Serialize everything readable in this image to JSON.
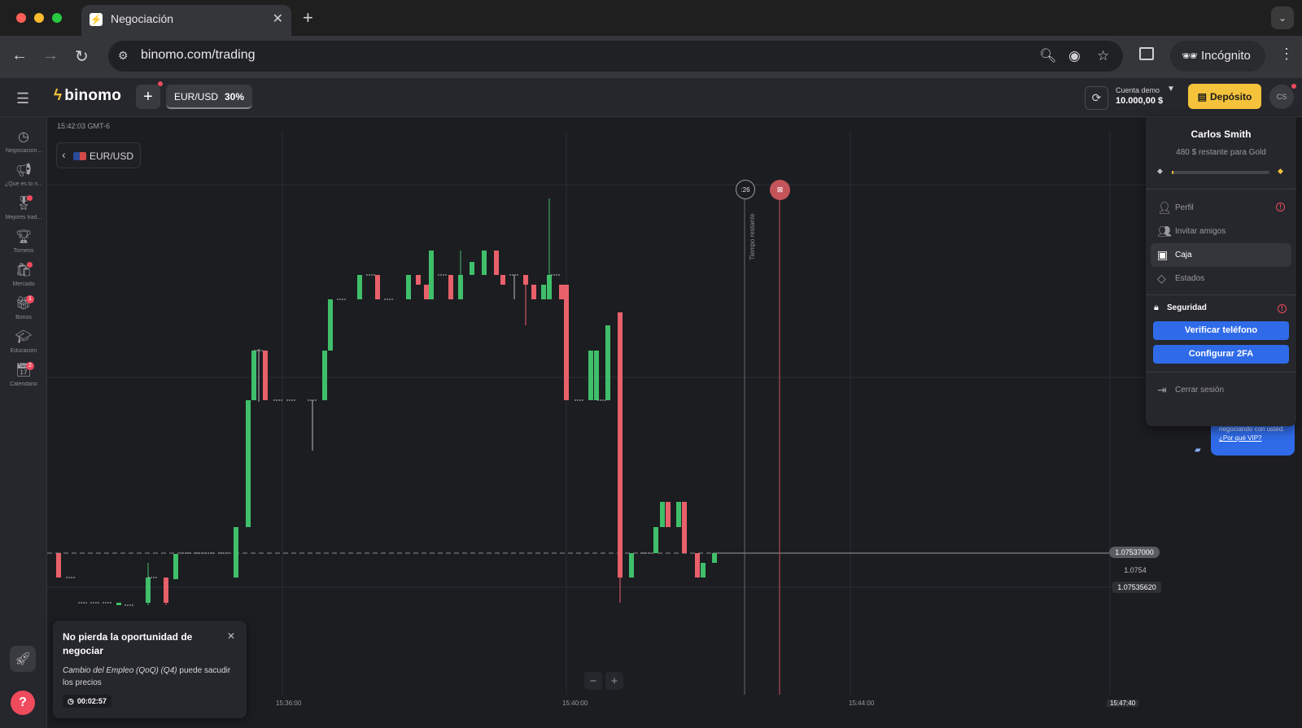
{
  "browser": {
    "tab_title": "Negociación",
    "url": "binomo.com/trading",
    "incognito_label": "Incógnito"
  },
  "header": {
    "logo": "binomo",
    "asset_chip": {
      "name": "EUR/USD",
      "payout": "30%"
    },
    "account_label": "Cuenta demo",
    "account_balance": "10.000,00 $",
    "deposit_label": "Depósito",
    "avatar_initials": "CS"
  },
  "sidebar": {
    "items": [
      {
        "label": "Negociacion...",
        "icon": "clock-icon",
        "badge": ""
      },
      {
        "label": "¿Qué es lo n...",
        "icon": "megaphone-icon",
        "badge": ""
      },
      {
        "label": "Mejores trad...",
        "icon": "ribbon-icon",
        "badge": ""
      },
      {
        "label": "Torneos",
        "icon": "trophy-icon",
        "badge": ""
      },
      {
        "label": "Mercado",
        "icon": "shop-icon",
        "badge": ""
      },
      {
        "label": "Bonos",
        "icon": "gift-icon",
        "badge": "1"
      },
      {
        "label": "Educación",
        "icon": "mortarboard-icon",
        "badge": ""
      },
      {
        "label": "Calendario",
        "icon": "calendar-icon",
        "badge": "2"
      }
    ]
  },
  "chart": {
    "clock": "15:42:03 GMT-6",
    "asset": "EUR/USD",
    "current_price": "1.07537000",
    "price_level": "1.0754",
    "strike_price": "1.07535620",
    "time_remaining": ":26",
    "time_remaining_label": "Tiempo restante",
    "x_labels": [
      "15:36:00",
      "15:40:00",
      "15:44:00",
      "15:47:40"
    ],
    "colors": {
      "up": "#3fbf6a",
      "down": "#e8606a",
      "expiry": "#c4545a"
    }
  },
  "notification": {
    "title": "No pierda la oportunidad de negociar",
    "event": "Cambio del Empleo (QoQ) (Q4)",
    "body_rest": " puede sacudir los precios",
    "timer": "00:02:57"
  },
  "vip": {
    "text": "negociando con usted.",
    "link": "¿Por qué VIP?"
  },
  "profile_menu": {
    "name": "Carlos Smith",
    "progress_text": "480 $ restante para Gold",
    "progress": 0.02,
    "items": [
      {
        "label": "Perfil",
        "icon": "user-icon"
      },
      {
        "label": "Invitar amigos",
        "icon": "user-plus-icon"
      },
      {
        "label": "Caja",
        "icon": "wallet-icon"
      },
      {
        "label": "Estados",
        "icon": "diamond-icon"
      }
    ],
    "security_label": "Seguridad",
    "verify_phone": "Verificar teléfono",
    "configure_2fa": "Configurar 2FA",
    "logout": "Cerrar sesión"
  }
}
